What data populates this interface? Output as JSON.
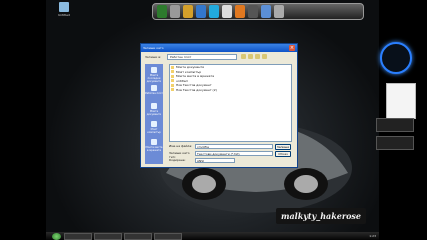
{
  "dialog": {
    "title": "Запиши като",
    "window_title": "Нов Текстов документ (2) - Notepad",
    "save_in_label": "Запиши в:",
    "save_in_value": "Работен плот",
    "places": [
      "Моите последни документи",
      "Работен плот",
      "Моите документи",
      "Моят компютър",
      "Моите места в мрежата"
    ],
    "files": [
      "Моите документи",
      "Моят компютър",
      "Моите места в мрежата",
      "untitled",
      "Нов Текстов документ",
      "Нов Текстов документ (2)"
    ],
    "filename_label": "Име на файла:",
    "filename_value": "cmd.file",
    "filetype_label": "Запиши като тип:",
    "filetype_value": "Текстови документи (*.txt)",
    "encoding_label": "Кодиране:",
    "encoding_value": "ANSI",
    "save_button": "Запиши",
    "cancel_button": "Отказ"
  },
  "desktop": {
    "icon_label": "Untitled",
    "logo_text": "malkyty_hakerose"
  },
  "colors": {
    "title_bar": "#0f54c8",
    "dialog_bg": "#ece9d8",
    "clock_ring": "#2a7fff"
  },
  "taskbar": {
    "tray": "1:23"
  }
}
